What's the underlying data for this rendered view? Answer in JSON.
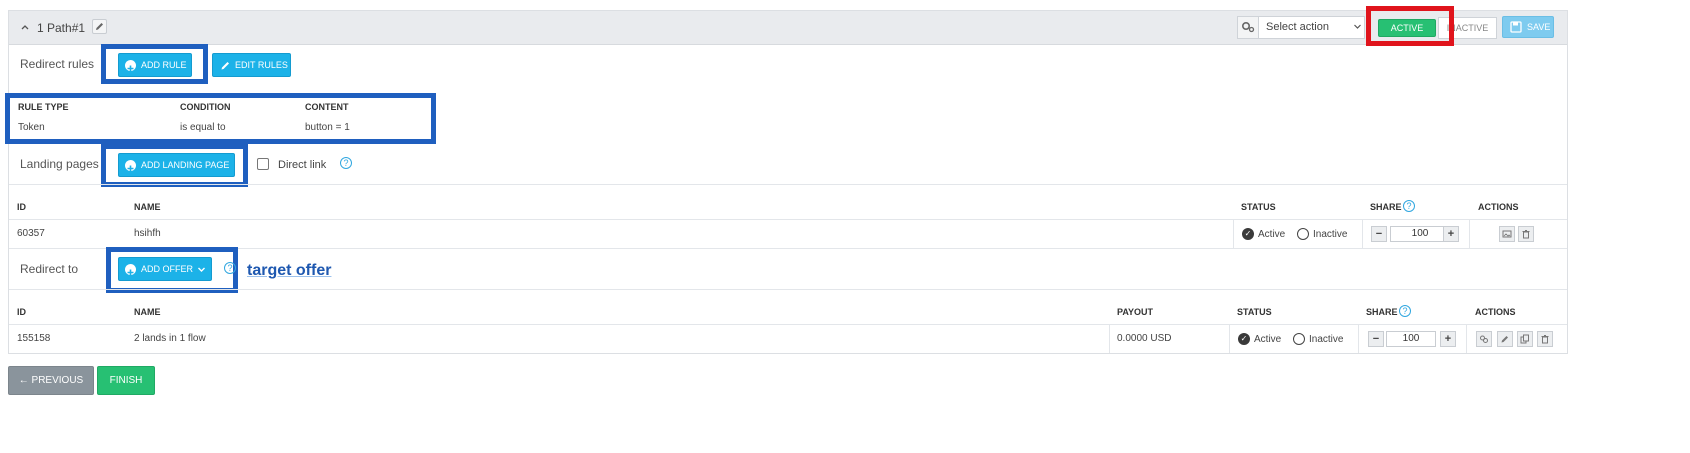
{
  "path": {
    "title": "1 Path#1"
  },
  "toolbar": {
    "select_action_placeholder": "Select action",
    "active_label": "ACTIVE",
    "inactive_label": "INACTIVE",
    "save_label": "SAVE"
  },
  "redirect_rules": {
    "label": "Redirect rules",
    "add_rule_label": "ADD RULE",
    "edit_rules_label": "EDIT RULES",
    "columns": [
      "RULE TYPE",
      "CONDITION",
      "CONTENT"
    ],
    "rows": [
      {
        "rule_type": "Token",
        "condition": "is equal to",
        "content": "button = 1"
      }
    ]
  },
  "landing_pages": {
    "label": "Landing pages",
    "add_label": "ADD LANDING PAGE",
    "direct_link_label": "Direct link",
    "columns": {
      "id": "ID",
      "name": "NAME",
      "status": "STATUS",
      "share": "SHARE",
      "actions": "ACTIONS"
    },
    "rows": [
      {
        "id": "60357",
        "name": "hsihfh",
        "status_active": "Active",
        "status_inactive": "Inactive",
        "share": "100"
      }
    ]
  },
  "redirect_to": {
    "label": "Redirect to",
    "add_offer_label": "ADD OFFER",
    "annotation": "target offer",
    "columns": {
      "id": "ID",
      "name": "NAME",
      "payout": "PAYOUT",
      "status": "STATUS",
      "share": "SHARE",
      "actions": "ACTIONS"
    },
    "rows": [
      {
        "id": "155158",
        "name": "2 lands in 1 flow",
        "payout": "0.0000 USD",
        "status_active": "Active",
        "status_inactive": "Inactive",
        "share": "100"
      }
    ]
  },
  "footer": {
    "previous_label": "← PREVIOUS",
    "finish_label": "FINISH"
  },
  "colors": {
    "accent_blue": "#1cb2e8",
    "active_green": "#27c073",
    "highlight_red": "#e0141c",
    "highlight_blue": "#1f5fbf"
  }
}
